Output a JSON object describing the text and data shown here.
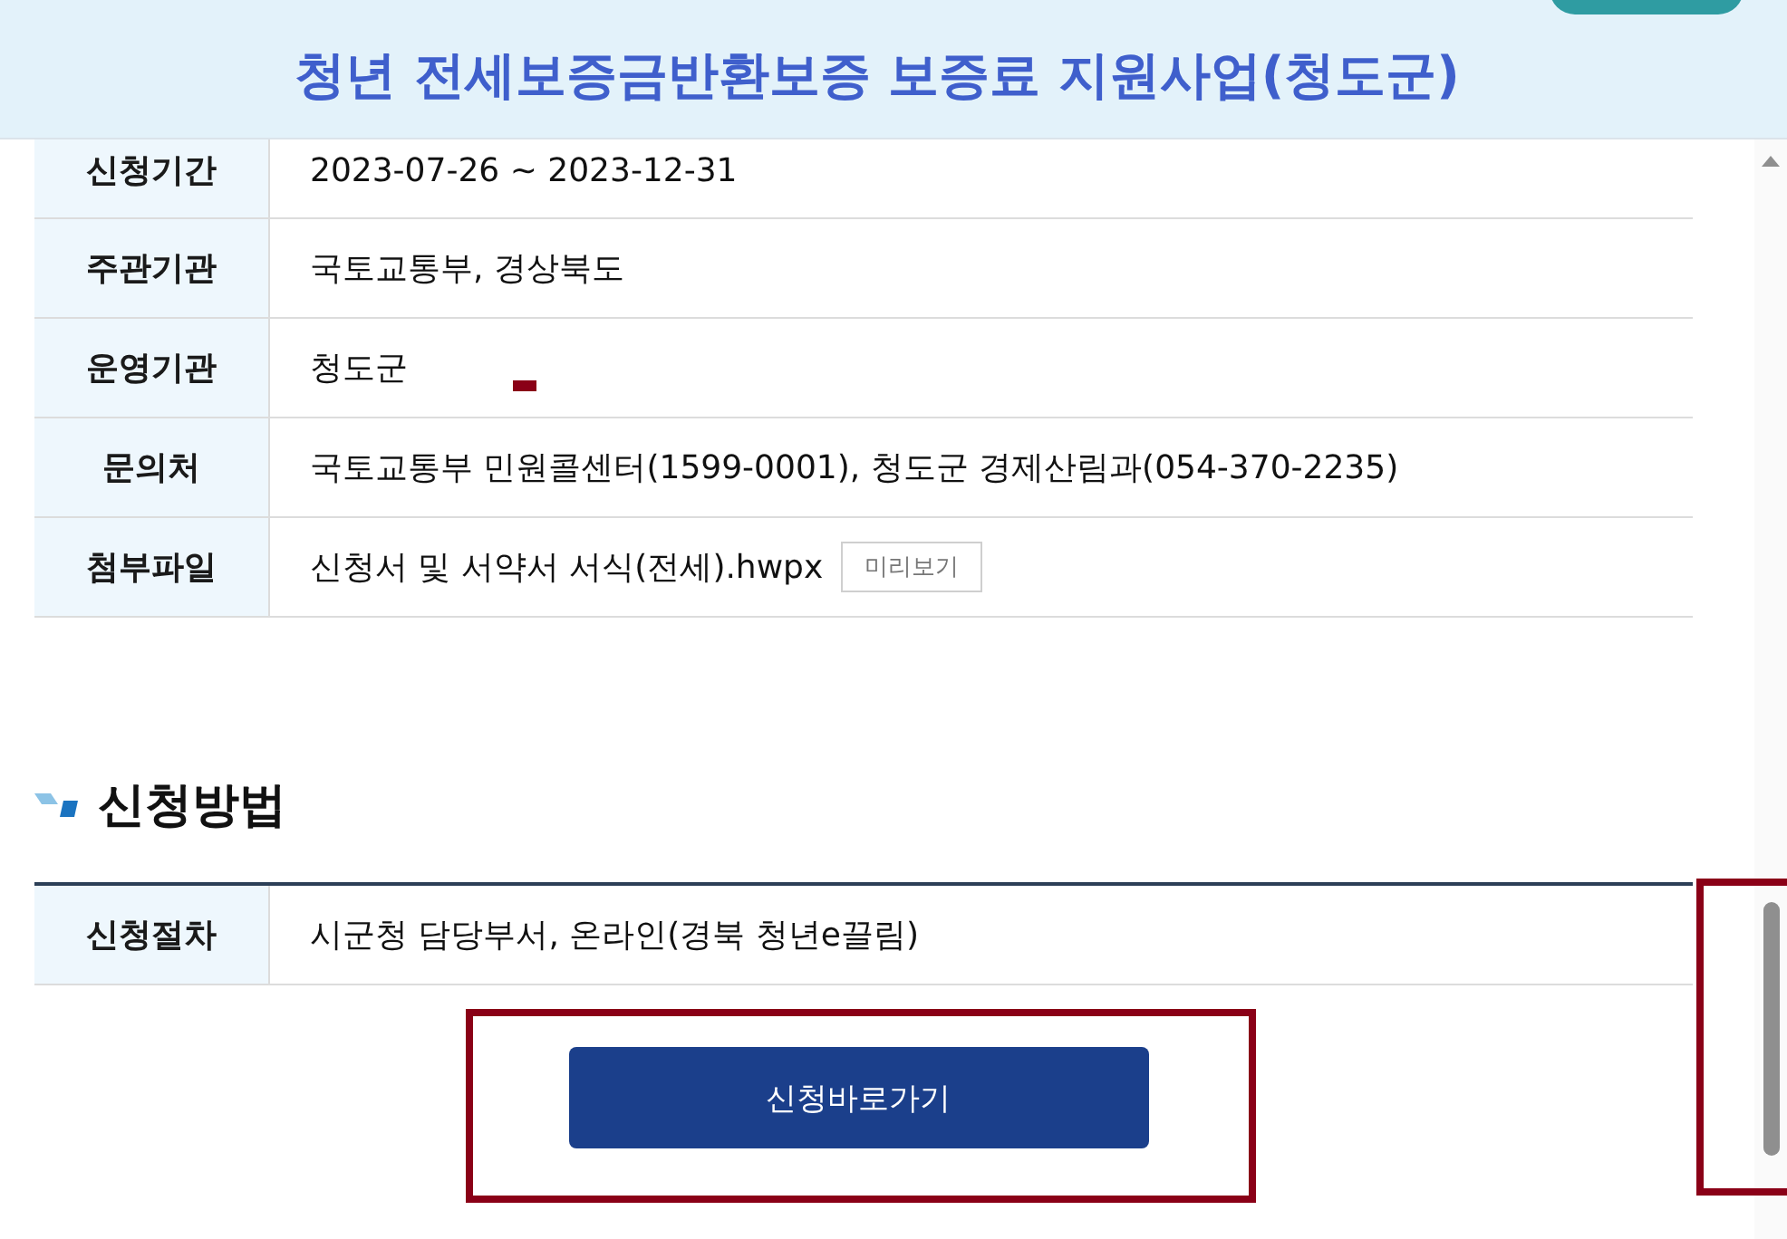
{
  "header": {
    "title": "청년 전세보증금반환보증 보증료 지원사업(청도군)"
  },
  "details": {
    "rows": [
      {
        "kind": "text",
        "label": "신청기간",
        "value": "2023-07-26 ~ 2023-12-31"
      },
      {
        "kind": "text",
        "label": "주관기관",
        "value": "국토교통부, 경상북도"
      },
      {
        "kind": "text",
        "label": "운영기관",
        "value": "청도군"
      },
      {
        "kind": "text",
        "label": "문의처",
        "value": "국토교통부 민원콜센터(1599-0001), 청도군 경제산림과(054-370-2235)"
      },
      {
        "kind": "file",
        "label": "첨부파일",
        "value": "신청서 및 서약서 서식(전세).hwpx",
        "button": "미리보기"
      }
    ]
  },
  "method": {
    "heading": "신청방법",
    "rows": [
      {
        "kind": "text",
        "label": "신청절차",
        "value": "시군청 담당부서, 온라인(경북 청년e끌림)"
      }
    ],
    "button": "신청바로가기"
  }
}
